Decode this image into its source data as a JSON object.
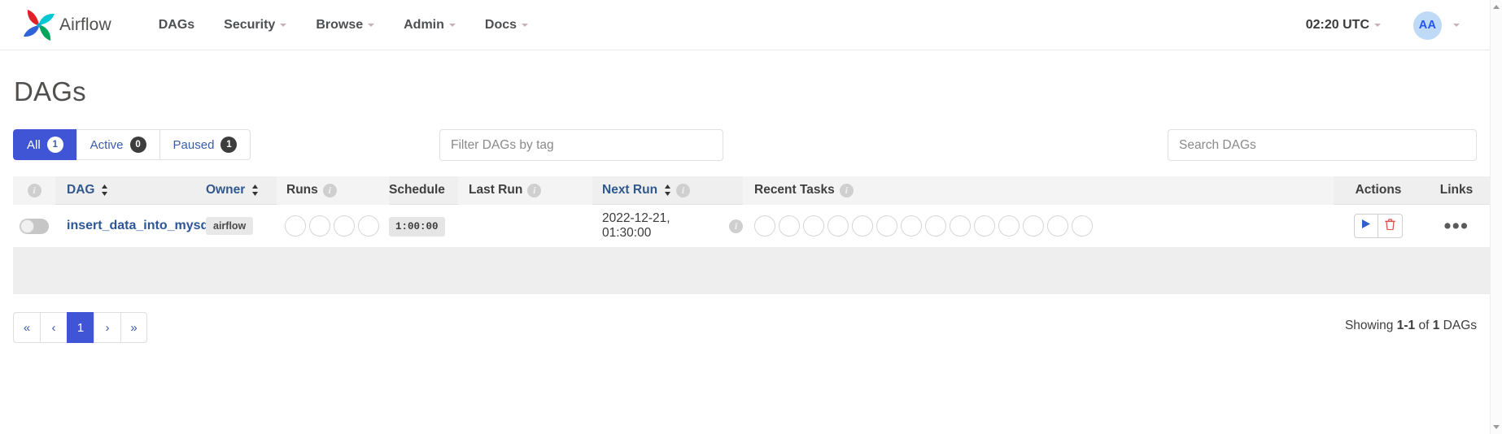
{
  "navbar": {
    "brand": "Airflow",
    "items": [
      {
        "label": "DAGs",
        "caret": false
      },
      {
        "label": "Security",
        "caret": true
      },
      {
        "label": "Browse",
        "caret": true
      },
      {
        "label": "Admin",
        "caret": true
      },
      {
        "label": "Docs",
        "caret": true
      }
    ],
    "timezone": "02:20 UTC",
    "avatar_initials": "AA"
  },
  "page": {
    "title": "DAGs"
  },
  "filters": {
    "tabs": [
      {
        "label": "All",
        "count": "1",
        "active": true
      },
      {
        "label": "Active",
        "count": "0",
        "active": false
      },
      {
        "label": "Paused",
        "count": "1",
        "active": false
      }
    ],
    "tag_filter_placeholder": "Filter DAGs by tag",
    "search_placeholder": "Search DAGs"
  },
  "table": {
    "headers": {
      "info": "i",
      "dag": "DAG",
      "owner": "Owner",
      "runs": "Runs",
      "schedule": "Schedule",
      "last_run": "Last Run",
      "next_run": "Next Run",
      "recent_tasks": "Recent Tasks",
      "actions": "Actions",
      "links": "Links"
    },
    "rows": [
      {
        "paused": true,
        "dag_id": "insert_data_into_mysql",
        "owner": "airflow",
        "runs_circles": 4,
        "schedule": "1:00:00",
        "last_run": "",
        "next_run": "2022-12-21, 01:30:00",
        "recent_tasks_circles": 14,
        "actions": {
          "trigger": "trigger-dag",
          "delete": "delete-dag"
        },
        "links": "•••"
      }
    ]
  },
  "pagination": {
    "first": "«",
    "prev": "‹",
    "pages": [
      "1"
    ],
    "next": "›",
    "last": "»",
    "showing_prefix": "Showing",
    "showing_range": "1-1",
    "showing_mid": "of",
    "showing_total": "1",
    "showing_suffix": "DAGs"
  },
  "colors": {
    "accent": "#4054d6",
    "link": "#2c5698",
    "danger": "#d9534f",
    "header_bg": "#efefef"
  }
}
